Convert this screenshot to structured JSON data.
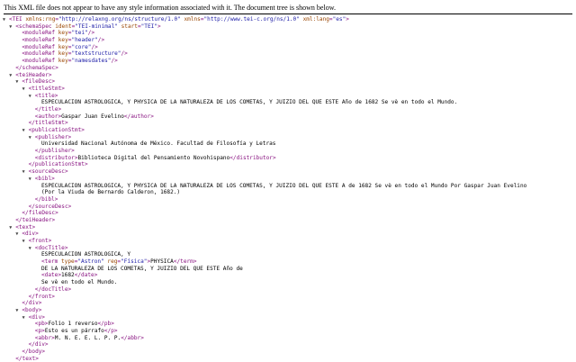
{
  "header": {
    "message": "This XML file does not appear to have any style information associated with it. The document tree is shown below."
  },
  "icons": {
    "expand": "triangle-down-icon"
  },
  "colors": {
    "tag": "#881280",
    "attr_name": "#994500",
    "attr_value": "#1a1aa6",
    "text": "#000000"
  },
  "tree": [
    {
      "indent": 0,
      "toggle": true,
      "parts": [
        [
          "tag",
          "<TEI "
        ],
        [
          "attr",
          "xmlns:rng"
        ],
        [
          "tag",
          "="
        ],
        [
          "val",
          "\"http://relaxng.org/ns/structure/1.0\""
        ],
        [
          "tag",
          " "
        ],
        [
          "attr",
          "xmlns"
        ],
        [
          "tag",
          "="
        ],
        [
          "val",
          "\"http://www.tei-c.org/ns/1.0\""
        ],
        [
          "tag",
          " "
        ],
        [
          "attr",
          "xml:lang"
        ],
        [
          "tag",
          "="
        ],
        [
          "val",
          "\"es\""
        ],
        [
          "tag",
          ">"
        ]
      ]
    },
    {
      "indent": 1,
      "toggle": true,
      "parts": [
        [
          "tag",
          "<schemaSpec "
        ],
        [
          "attr",
          "ident"
        ],
        [
          "tag",
          "="
        ],
        [
          "val",
          "\"TEI-minimal\""
        ],
        [
          "tag",
          " "
        ],
        [
          "attr",
          "start"
        ],
        [
          "tag",
          "="
        ],
        [
          "val",
          "\"TEI\""
        ],
        [
          "tag",
          ">"
        ]
      ]
    },
    {
      "indent": 2,
      "toggle": false,
      "parts": [
        [
          "tag",
          "<moduleRef "
        ],
        [
          "attr",
          "key"
        ],
        [
          "tag",
          "="
        ],
        [
          "val",
          "\"tei\""
        ],
        [
          "tag",
          "/>"
        ]
      ]
    },
    {
      "indent": 2,
      "toggle": false,
      "parts": [
        [
          "tag",
          "<moduleRef "
        ],
        [
          "attr",
          "key"
        ],
        [
          "tag",
          "="
        ],
        [
          "val",
          "\"header\""
        ],
        [
          "tag",
          "/>"
        ]
      ]
    },
    {
      "indent": 2,
      "toggle": false,
      "parts": [
        [
          "tag",
          "<moduleRef "
        ],
        [
          "attr",
          "key"
        ],
        [
          "tag",
          "="
        ],
        [
          "val",
          "\"core\""
        ],
        [
          "tag",
          "/>"
        ]
      ]
    },
    {
      "indent": 2,
      "toggle": false,
      "parts": [
        [
          "tag",
          "<moduleRef "
        ],
        [
          "attr",
          "key"
        ],
        [
          "tag",
          "="
        ],
        [
          "val",
          "\"textstructure\""
        ],
        [
          "tag",
          "/>"
        ]
      ]
    },
    {
      "indent": 2,
      "toggle": false,
      "parts": [
        [
          "tag",
          "<moduleRef "
        ],
        [
          "attr",
          "key"
        ],
        [
          "tag",
          "="
        ],
        [
          "val",
          "\"namesdates\""
        ],
        [
          "tag",
          "/>"
        ]
      ]
    },
    {
      "indent": 1,
      "toggle": false,
      "parts": [
        [
          "tag",
          "</schemaSpec>"
        ]
      ]
    },
    {
      "indent": 1,
      "toggle": true,
      "parts": [
        [
          "tag",
          "<teiHeader>"
        ]
      ]
    },
    {
      "indent": 2,
      "toggle": true,
      "parts": [
        [
          "tag",
          "<fileDesc>"
        ]
      ]
    },
    {
      "indent": 3,
      "toggle": true,
      "parts": [
        [
          "tag",
          "<titleStmt>"
        ]
      ]
    },
    {
      "indent": 4,
      "toggle": true,
      "parts": [
        [
          "tag",
          "<title>"
        ]
      ]
    },
    {
      "indent": 5,
      "toggle": false,
      "parts": [
        [
          "txt",
          "ESPECULACION ASTROLOGICA, Y PHYSICA DE LA NATURALEZA DE LOS COMETAS, Y JUIZIO DEL QUE ESTE Año de 1682 Se vè en todo el Mundo."
        ]
      ]
    },
    {
      "indent": 4,
      "toggle": false,
      "parts": [
        [
          "tag",
          "</title>"
        ]
      ]
    },
    {
      "indent": 4,
      "toggle": false,
      "parts": [
        [
          "tag",
          "<author>"
        ],
        [
          "txt",
          "Gaspar Juan Evelino"
        ],
        [
          "tag",
          "</author>"
        ]
      ]
    },
    {
      "indent": 3,
      "toggle": false,
      "parts": [
        [
          "tag",
          "</titleStmt>"
        ]
      ]
    },
    {
      "indent": 3,
      "toggle": true,
      "parts": [
        [
          "tag",
          "<publicationStmt>"
        ]
      ]
    },
    {
      "indent": 4,
      "toggle": true,
      "parts": [
        [
          "tag",
          "<publisher>"
        ]
      ]
    },
    {
      "indent": 5,
      "toggle": false,
      "parts": [
        [
          "txt",
          "Universidad Nacional Autónoma de México. Facultad de Filosofía y Letras"
        ]
      ]
    },
    {
      "indent": 4,
      "toggle": false,
      "parts": [
        [
          "tag",
          "</publisher>"
        ]
      ]
    },
    {
      "indent": 4,
      "toggle": false,
      "parts": [
        [
          "tag",
          "<distributor>"
        ],
        [
          "txt",
          "Biblioteca Digital del Pensamiento Novohispano"
        ],
        [
          "tag",
          "</distributor>"
        ]
      ]
    },
    {
      "indent": 3,
      "toggle": false,
      "parts": [
        [
          "tag",
          "</publicationStmt>"
        ]
      ]
    },
    {
      "indent": 3,
      "toggle": true,
      "parts": [
        [
          "tag",
          "<sourceDesc>"
        ]
      ]
    },
    {
      "indent": 4,
      "toggle": true,
      "parts": [
        [
          "tag",
          "<bibl>"
        ]
      ]
    },
    {
      "indent": 5,
      "toggle": false,
      "parts": [
        [
          "txt",
          "ESPECULACION ASTROLOGICA, Y PHYSICA DE LA NATURALEZA DE LOS COMETAS, Y JUIZIO DEL QUE ESTE A de 1682 Se vè en todo el Mundo Por Gaspar Juan Evelino"
        ]
      ]
    },
    {
      "indent": 5,
      "toggle": false,
      "parts": [
        [
          "txt",
          "(Por la Viuda de Bernardo Calderon, 1682.)"
        ]
      ]
    },
    {
      "indent": 4,
      "toggle": false,
      "parts": [
        [
          "tag",
          "</bibl>"
        ]
      ]
    },
    {
      "indent": 3,
      "toggle": false,
      "parts": [
        [
          "tag",
          "</sourceDesc>"
        ]
      ]
    },
    {
      "indent": 2,
      "toggle": false,
      "parts": [
        [
          "tag",
          "</fileDesc>"
        ]
      ]
    },
    {
      "indent": 1,
      "toggle": false,
      "parts": [
        [
          "tag",
          "</teiHeader>"
        ]
      ]
    },
    {
      "indent": 1,
      "toggle": true,
      "parts": [
        [
          "tag",
          "<text>"
        ]
      ]
    },
    {
      "indent": 2,
      "toggle": true,
      "parts": [
        [
          "tag",
          "<div>"
        ]
      ]
    },
    {
      "indent": 3,
      "toggle": true,
      "parts": [
        [
          "tag",
          "<front>"
        ]
      ]
    },
    {
      "indent": 4,
      "toggle": true,
      "parts": [
        [
          "tag",
          "<docTitle>"
        ]
      ]
    },
    {
      "indent": 5,
      "toggle": false,
      "parts": [
        [
          "txt",
          "ESPECULACION ASTROLOGICA, Y"
        ]
      ]
    },
    {
      "indent": 5,
      "toggle": false,
      "parts": [
        [
          "tag",
          "<term "
        ],
        [
          "attr",
          "type"
        ],
        [
          "tag",
          "="
        ],
        [
          "val",
          "\"Astron\""
        ],
        [
          "tag",
          " "
        ],
        [
          "attr",
          "reg"
        ],
        [
          "tag",
          "="
        ],
        [
          "val",
          "\"Física\""
        ],
        [
          "tag",
          ">"
        ],
        [
          "txt",
          "PHYSICA"
        ],
        [
          "tag",
          "</term>"
        ]
      ]
    },
    {
      "indent": 5,
      "toggle": false,
      "parts": [
        [
          "txt",
          "DE LA NATURALEZA DE LOS COMETAS, Y JUIZIO DEL QUE ESTE Año de"
        ]
      ]
    },
    {
      "indent": 5,
      "toggle": false,
      "parts": [
        [
          "tag",
          "<date>"
        ],
        [
          "txt",
          "1682"
        ],
        [
          "tag",
          "</date>"
        ]
      ]
    },
    {
      "indent": 5,
      "toggle": false,
      "parts": [
        [
          "txt",
          "Se vè en todo el Mundo."
        ]
      ]
    },
    {
      "indent": 4,
      "toggle": false,
      "parts": [
        [
          "tag",
          "</docTitle>"
        ]
      ]
    },
    {
      "indent": 3,
      "toggle": false,
      "parts": [
        [
          "tag",
          "</front>"
        ]
      ]
    },
    {
      "indent": 2,
      "toggle": false,
      "parts": [
        [
          "tag",
          "</div>"
        ]
      ]
    },
    {
      "indent": 2,
      "toggle": true,
      "parts": [
        [
          "tag",
          "<body>"
        ]
      ]
    },
    {
      "indent": 3,
      "toggle": true,
      "parts": [
        [
          "tag",
          "<div>"
        ]
      ]
    },
    {
      "indent": 4,
      "toggle": false,
      "parts": [
        [
          "tag",
          "<pb>"
        ],
        [
          "txt",
          "Folio 1 reverso"
        ],
        [
          "tag",
          "</pb>"
        ]
      ]
    },
    {
      "indent": 4,
      "toggle": false,
      "parts": [
        [
          "tag",
          "<p>"
        ],
        [
          "txt",
          "Esto es un párrafo"
        ],
        [
          "tag",
          "</p>"
        ]
      ]
    },
    {
      "indent": 4,
      "toggle": false,
      "parts": [
        [
          "tag",
          "<abbr>"
        ],
        [
          "txt",
          "M. N. E. E. L. P. P."
        ],
        [
          "tag",
          "</abbr>"
        ]
      ]
    },
    {
      "indent": 3,
      "toggle": false,
      "parts": [
        [
          "tag",
          "</div>"
        ]
      ]
    },
    {
      "indent": 2,
      "toggle": false,
      "parts": [
        [
          "tag",
          "</body>"
        ]
      ]
    },
    {
      "indent": 1,
      "toggle": false,
      "parts": [
        [
          "tag",
          "</text>"
        ]
      ]
    }
  ]
}
